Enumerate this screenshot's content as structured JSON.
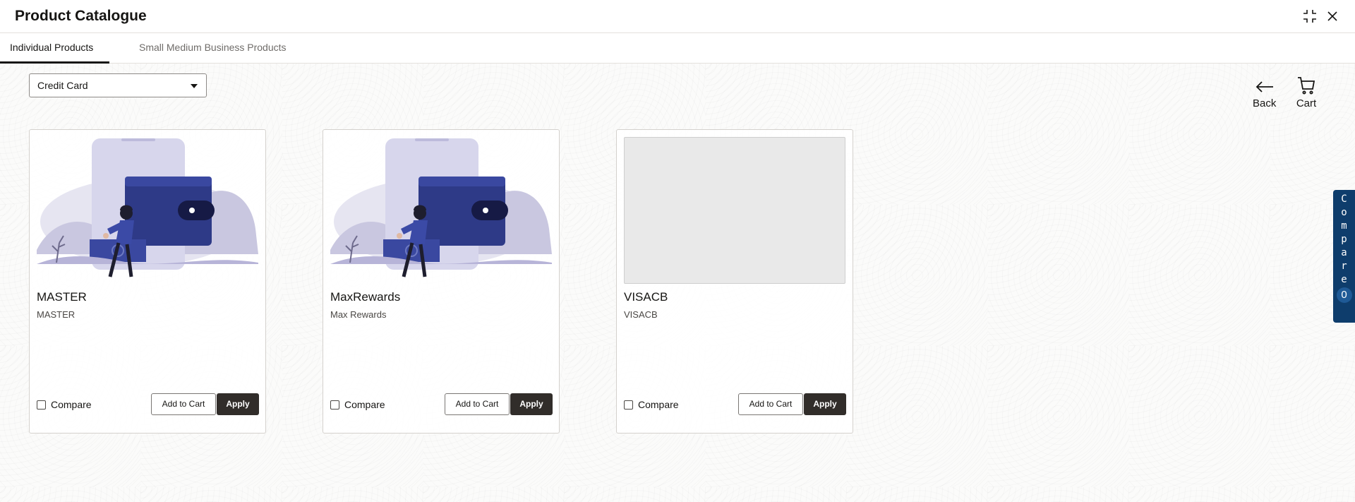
{
  "window": {
    "title": "Product Catalogue",
    "maximize_icon": "collapse-icon",
    "close_icon": "close-icon"
  },
  "tabs": [
    {
      "label": "Individual Products",
      "active": true
    },
    {
      "label": "Small Medium Business Products",
      "active": false
    }
  ],
  "filter": {
    "selected": "Credit Card"
  },
  "actions": {
    "back_label": "Back",
    "cart_label": "Cart"
  },
  "products": [
    {
      "name": "MASTER",
      "description": "MASTER",
      "image": "wallet-illustration",
      "compare_label": "Compare",
      "add_to_cart_label": "Add to Cart",
      "apply_label": "Apply"
    },
    {
      "name": "MaxRewards",
      "description": "Max Rewards",
      "image": "wallet-illustration",
      "compare_label": "Compare",
      "add_to_cart_label": "Add to Cart",
      "apply_label": "Apply"
    },
    {
      "name": "VISACB",
      "description": "VISACB",
      "image": "placeholder",
      "compare_label": "Compare",
      "add_to_cart_label": "Add to Cart",
      "apply_label": "Apply"
    }
  ],
  "compare_panel": {
    "label": "Compare",
    "count": "0"
  },
  "colors": {
    "primary_button": "#312d2a",
    "compare_panel": "#0e3d6c",
    "illustration_primary": "#2e3a87",
    "illustration_light": "#d7d6ec"
  }
}
